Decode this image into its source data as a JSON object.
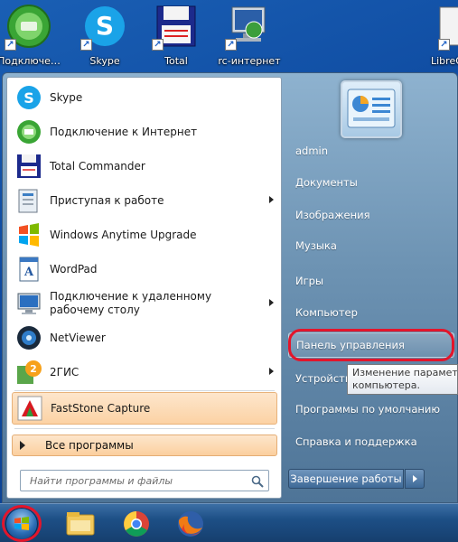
{
  "desktop": {
    "icons": [
      {
        "label": "Подключе…",
        "icon": "internet-connection-icon"
      },
      {
        "label": "Skype",
        "icon": "skype-icon"
      },
      {
        "label": "Total",
        "icon": "total-commander-icon"
      },
      {
        "label": "rc-интернет",
        "icon": "network-computer-icon"
      },
      {
        "label": "LibreO",
        "icon": "libreoffice-icon"
      }
    ]
  },
  "start_menu": {
    "programs": [
      {
        "label": "Skype",
        "icon": "skype-icon"
      },
      {
        "label": "Подключение к Интернет",
        "icon": "internet-connection-icon"
      },
      {
        "label": "Total Commander",
        "icon": "total-commander-icon"
      },
      {
        "label": "Приступая к работе",
        "icon": "getting-started-icon",
        "submenu": true
      },
      {
        "label": "Windows Anytime Upgrade",
        "icon": "windows-flag-icon"
      },
      {
        "label": "WordPad",
        "icon": "wordpad-icon"
      },
      {
        "label": "Подключение к удаленному рабочему столу",
        "icon": "remote-desktop-icon",
        "submenu": true
      },
      {
        "label": "NetViewer",
        "icon": "netviewer-icon"
      },
      {
        "label": "2ГИС",
        "icon": "2gis-icon",
        "submenu": true
      },
      {
        "label": "FastStone Capture",
        "icon": "faststone-capture-icon",
        "highlighted": true
      }
    ],
    "all_programs_label": "Все программы",
    "search_placeholder": "Найти программы и файлы",
    "right_items": [
      {
        "label": "admin"
      },
      {
        "label": "Документы"
      },
      {
        "label": "Изображения"
      },
      {
        "label": "Музыка"
      },
      {
        "label": "Игры"
      },
      {
        "label": "Компьютер"
      },
      {
        "label": "Панель управления",
        "highlighted": true
      },
      {
        "label": "Устройства"
      },
      {
        "label": "Программы по умолчанию"
      },
      {
        "label": "Справка и поддержка"
      }
    ],
    "shutdown_label": "Завершение работы",
    "tooltip": {
      "line1": "Изменение параметров",
      "line2": "компьютера."
    }
  },
  "taskbar": {
    "pinned": [
      {
        "icon": "explorer-folder-icon"
      },
      {
        "icon": "chrome-icon"
      },
      {
        "icon": "firefox-icon"
      }
    ]
  },
  "colors": {
    "highlight_ring": "#e3152b",
    "hover_orange": "#fcd2a4",
    "desktop_blue": "#1a5fb4"
  }
}
